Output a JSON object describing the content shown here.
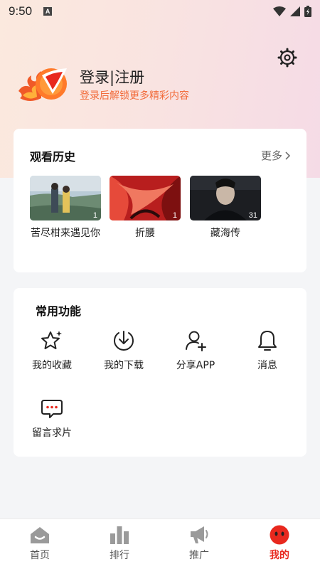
{
  "status_bar": {
    "time": "9:50",
    "notification_icon": "A"
  },
  "profile": {
    "title": "登录|注册",
    "subtitle": "登录后解锁更多精彩内容"
  },
  "history": {
    "title": "观看历史",
    "more_label": "更多",
    "items": [
      {
        "title": "苦尽柑来遇见你",
        "badge": "1"
      },
      {
        "title": "折腰",
        "badge": "1"
      },
      {
        "title": "藏海传",
        "badge": "31"
      }
    ]
  },
  "functions": {
    "title": "常用功能",
    "items": [
      {
        "label": "我的收藏",
        "icon": "star-icon"
      },
      {
        "label": "我的下载",
        "icon": "download-icon"
      },
      {
        "label": "分享APP",
        "icon": "share-user-icon"
      },
      {
        "label": "消息",
        "icon": "bell-icon"
      },
      {
        "label": "留言求片",
        "icon": "chat-icon"
      }
    ]
  },
  "tabbar": {
    "items": [
      {
        "label": "首页",
        "icon": "home-icon"
      },
      {
        "label": "排行",
        "icon": "ranking-icon"
      },
      {
        "label": "推广",
        "icon": "megaphone-icon"
      },
      {
        "label": "我的",
        "icon": "profile-icon",
        "active": true
      }
    ]
  },
  "colors": {
    "accent": "#e8281e",
    "subtitle": "#f26b3a",
    "icon_gray": "#9a9a9a"
  }
}
